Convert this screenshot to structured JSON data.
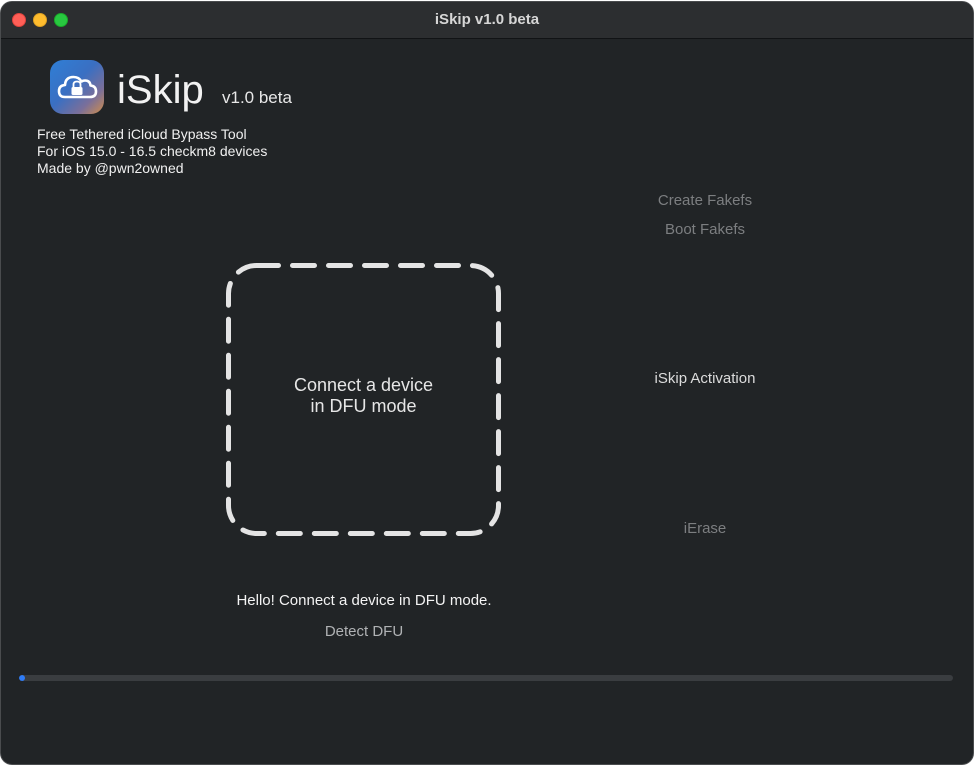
{
  "window": {
    "title": "iSkip v1.0 beta"
  },
  "header": {
    "app_name": "iSkip",
    "version": "v1.0 beta",
    "icon": "cloud-lock-icon",
    "description_lines": [
      "Free Tethered iCloud Bypass Tool",
      "For iOS 15.0 - 16.5 checkm8 devices",
      "Made by @pwn2owned"
    ]
  },
  "dropzone": {
    "line1": "Connect a device",
    "line2": "in DFU mode"
  },
  "actions": {
    "create_fakefs": "Create Fakefs",
    "boot_fakefs": "Boot Fakefs",
    "iskip_activation": "iSkip Activation",
    "ierase": "iErase"
  },
  "status": {
    "message": "Hello! Connect a device in DFU mode.",
    "detect_dfu": "Detect DFU"
  },
  "progress": {
    "value": 0.005
  },
  "colors": {
    "window_bg": "#212426",
    "accent": "#2f7cf6",
    "disabled_text": "#7c7e80"
  }
}
